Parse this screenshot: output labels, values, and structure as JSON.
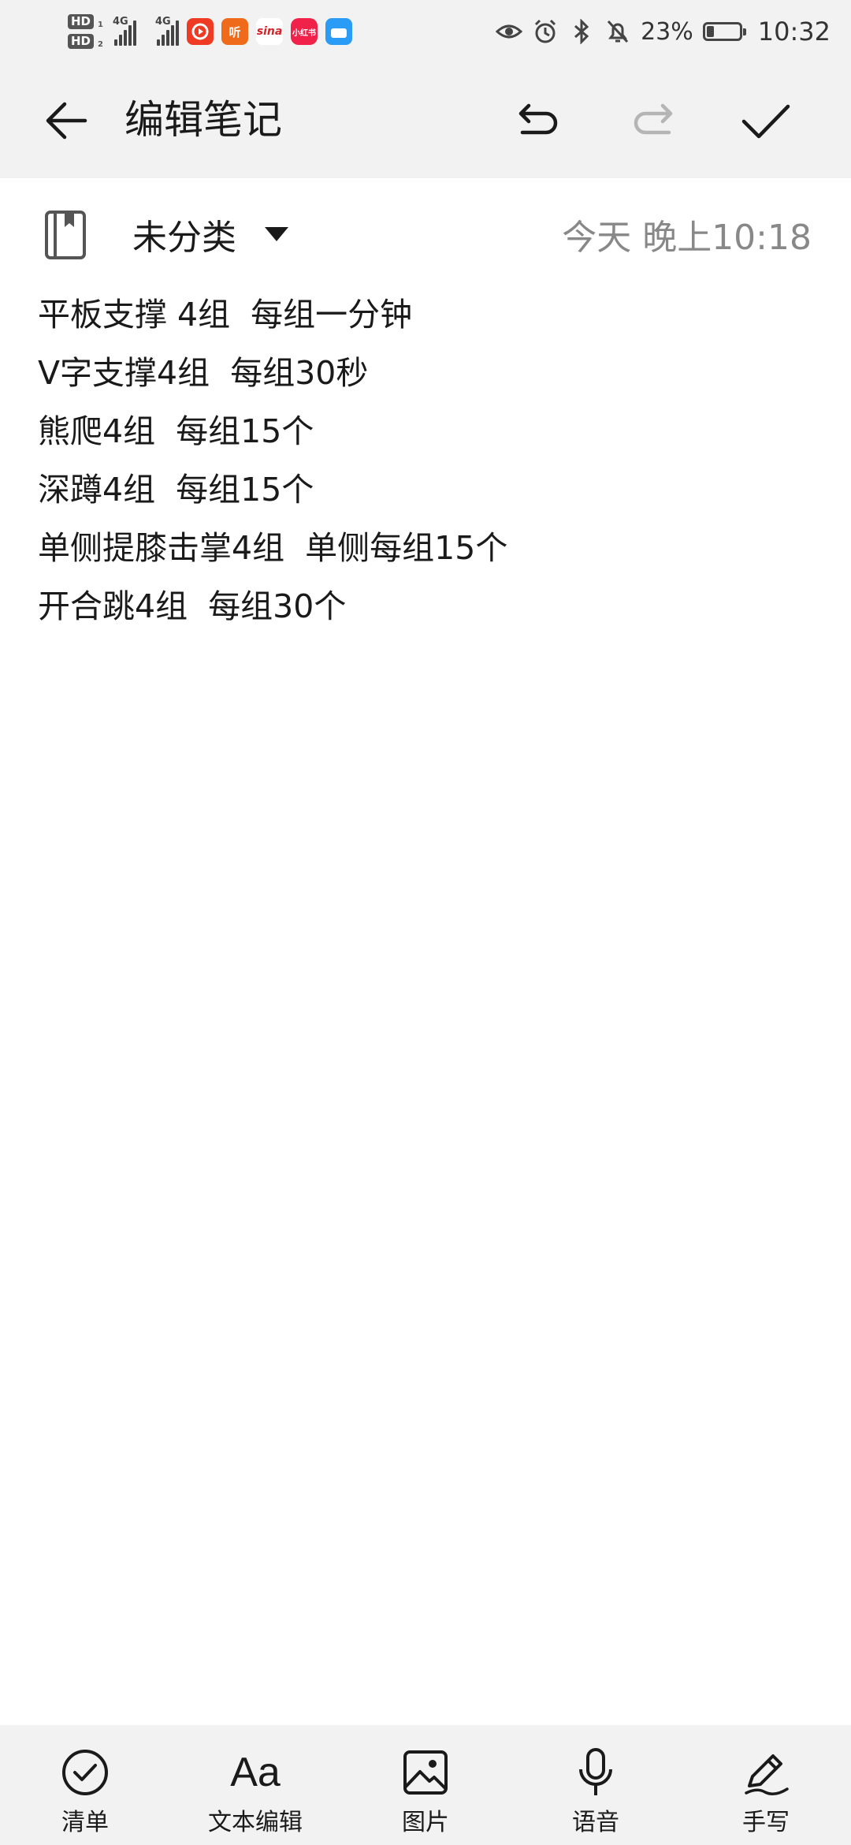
{
  "status_bar": {
    "hd1": "HD",
    "hd1_sub": "1",
    "hd2": "HD",
    "hd2_sub": "2",
    "net1": "4G",
    "net2": "4G",
    "app_icons": [
      "video-app-icon",
      "listen-app-icon",
      "sina-app-icon",
      "xiaohongshu-app-icon",
      "blue-app-icon"
    ],
    "listen_label": "听",
    "sina_label": "sina",
    "red_label": "小红书",
    "battery_percent": "23%",
    "battery_level": 0.23,
    "time": "10:32"
  },
  "toolbar": {
    "title": "编辑笔记"
  },
  "note": {
    "category": "未分类",
    "timestamp": "今天 晚上10:18",
    "lines": [
      "平板支撑 4组  每组一分钟",
      "V字支撑4组  每组30秒",
      "熊爬4组  每组15个",
      "深蹲4组  每组15个",
      "单侧提膝击掌4组  单侧每组15个",
      "开合跳4组  每组30个"
    ]
  },
  "bottom_bar": {
    "checklist": "清单",
    "text_edit": "文本编辑",
    "text_edit_icon": "Aa",
    "image": "图片",
    "voice": "语音",
    "handwrite": "手写"
  },
  "colors": {
    "bar_background": "#f2f2f2",
    "text": "#1a1a1a",
    "muted": "#888888",
    "disabled": "#b5b5b5"
  }
}
